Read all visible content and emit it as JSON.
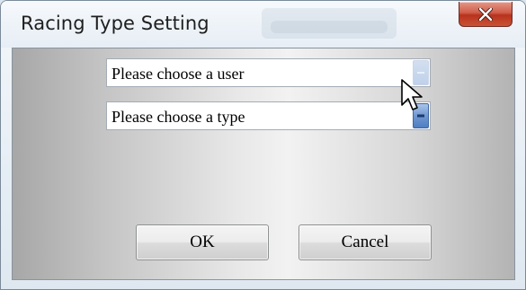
{
  "window": {
    "title": "Racing Type Setting"
  },
  "form": {
    "user_select": {
      "value": "Please choose a user",
      "state": "disabled"
    },
    "type_select": {
      "value": "Please choose a type",
      "state": "hover"
    }
  },
  "buttons": {
    "ok_label": "OK",
    "cancel_label": "Cancel"
  },
  "icons": {
    "close": "close-icon",
    "dropdown": "chevron-down-icon",
    "cursor": "mouse-pointer-icon"
  },
  "colors": {
    "close_button": "#c94a33",
    "dropdown_hover": "#5f8ccc",
    "dropdown_disabled": "#c6d5ea"
  }
}
